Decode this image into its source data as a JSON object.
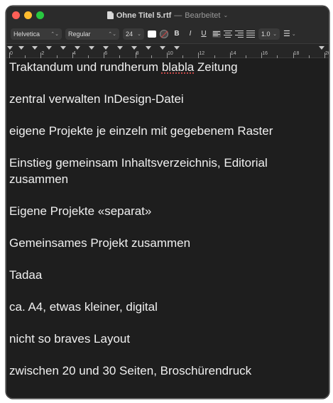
{
  "window": {
    "title": "Ohne Titel 5.rtf",
    "separator": "—",
    "status": "Bearbeitet",
    "status_icon": "chevron-down-icon"
  },
  "toolbar": {
    "font_family": "Helvetica",
    "font_style": "Regular",
    "font_size": "24",
    "text_color": "#ffffff",
    "bold": "B",
    "italic": "I",
    "underline": "U",
    "line_spacing": "1.0",
    "list_icon": "list-icon"
  },
  "ruler": {
    "labels": [
      "0",
      "2",
      "4",
      "6",
      "8",
      "10",
      "12",
      "14",
      "16",
      "18",
      "20"
    ]
  },
  "document": {
    "paragraphs": [
      {
        "before": "Traktandum und rundherum ",
        "misspelled": "blabla",
        "after": " Zeitung"
      },
      {
        "text": "zentral verwalten InDesign-Datei"
      },
      {
        "text": "eigene Projekte je einzeln mit gegebenem Raster"
      },
      {
        "text": "Einstieg gemeinsam Inhaltsverzeichnis, Editorial zusammen"
      },
      {
        "text": "Eigene Projekte «separat»"
      },
      {
        "text": "Gemeinsames Projekt zusammen"
      },
      {
        "text": "Tadaa"
      },
      {
        "text": "ca. A4, etwas kleiner, digital"
      },
      {
        "text": "nicht so braves Layout"
      },
      {
        "text": "zwischen 20 und 30 Seiten, Broschürendruck"
      }
    ]
  }
}
